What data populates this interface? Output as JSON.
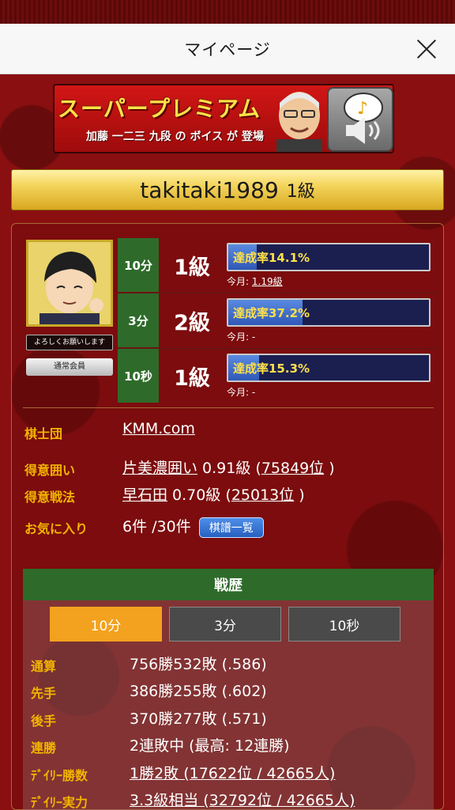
{
  "nav": {
    "title": "マイページ"
  },
  "banner": {
    "title": "スーパープレミアム",
    "subtitle": "加藤 一二三 九段 の ボイス が 登場"
  },
  "user": {
    "name": "takitaki1989",
    "rank": "1級"
  },
  "profile": {
    "greeting": "よろしくお願いします",
    "member_type": "通常会員"
  },
  "ranks": [
    {
      "time": "10分",
      "rank": "1級",
      "rate_text": "達成率14.1%",
      "rate": 0.141,
      "month_label": "今月:",
      "month_value": "1.19級"
    },
    {
      "time": "3分",
      "rank": "2級",
      "rate_text": "達成率37.2%",
      "rate": 0.372,
      "month_label": "今月:",
      "month_value": "-"
    },
    {
      "time": "10秒",
      "rank": "1級",
      "rate_text": "達成率15.3%",
      "rate": 0.153,
      "month_label": "今月:",
      "month_value": "-"
    }
  ],
  "info": {
    "club_label": "棋士団",
    "club_value": "KMM.com",
    "castle_label": "得意囲い",
    "castle_name": "片美濃囲い",
    "castle_grade": " 0.91級 (",
    "castle_pos": "75849位",
    "castle_end": " )",
    "strategy_label": "得意戦法",
    "strategy_name": "早石田",
    "strategy_grade": " 0.70級 (",
    "strategy_pos": "25013位",
    "strategy_end": " )",
    "fav_label": "お気に入り",
    "fav_value": "6件 /30件",
    "kifu_button": "棋譜一覧"
  },
  "record": {
    "title": "戦歴",
    "tabs": [
      "10分",
      "3分",
      "10秒"
    ],
    "active_tab": 0,
    "rows": [
      {
        "label": "通算",
        "value": "756勝532敗 (.586)"
      },
      {
        "label": "先手",
        "value": "386勝255敗 (.602)"
      },
      {
        "label": "後手",
        "value": "370勝277敗 (.571)"
      },
      {
        "label": "連勝",
        "value": "2連敗中 (最高: 12連勝)"
      },
      {
        "label": "ﾃﾞｲﾘｰ勝数",
        "value": "1勝2敗 (17622位 / 42665人)"
      },
      {
        "label": "ﾃﾞｲﾘｰ実力",
        "value": "3.3級相当 (32792位 / 42665人)"
      }
    ]
  },
  "colors": {
    "accent": "#f2a21e",
    "label": "#f2b400",
    "header_green": "#2e6b2a",
    "background": "#8a0f10"
  }
}
